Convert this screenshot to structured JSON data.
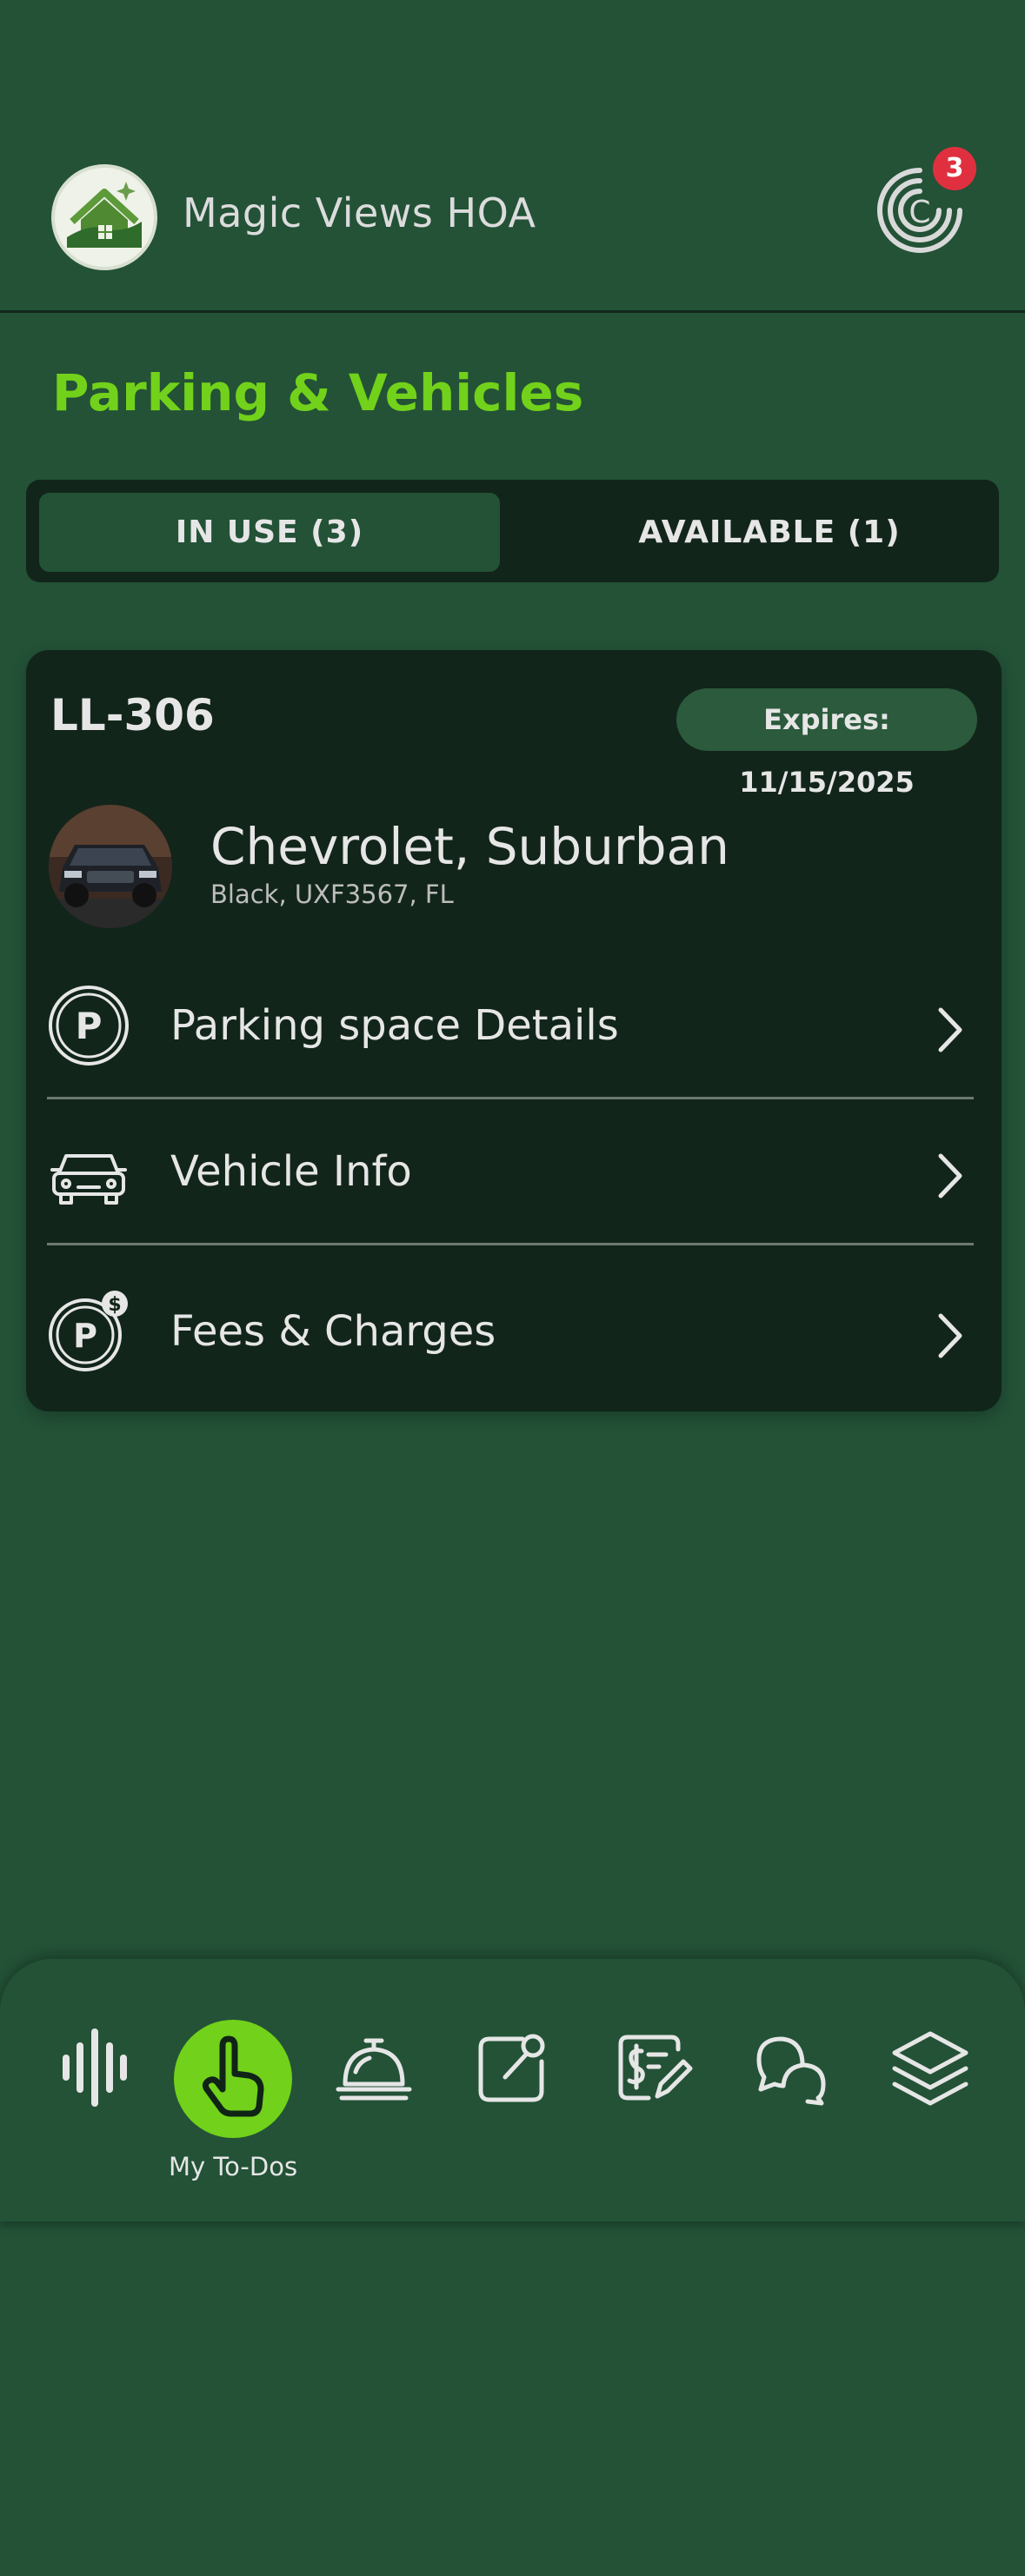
{
  "app": {
    "title": "Magic Views HOA",
    "notification_count": "3"
  },
  "page": {
    "title": "Parking & Vehicles"
  },
  "tabs": [
    {
      "label": "IN USE (3)",
      "active": true
    },
    {
      "label": "AVAILABLE (1)",
      "active": false
    }
  ],
  "card": {
    "space_id": "LL-306",
    "expires": "Expires: 11/15/2025",
    "vehicle": {
      "name": "Chevrolet, Suburban",
      "details": "Black,  UXF3567, FL"
    },
    "rows": [
      {
        "label": "Parking space Details",
        "icon": "parking-icon"
      },
      {
        "label": "Vehicle Info",
        "icon": "car-icon"
      },
      {
        "label": "Fees & Charges",
        "icon": "parking-fee-icon"
      }
    ]
  },
  "bottom_nav": {
    "items": [
      {
        "icon": "voice-wave-icon"
      },
      {
        "icon": "pointing-hand-icon",
        "label": "My To-Dos",
        "active": true
      },
      {
        "icon": "service-bell-icon"
      },
      {
        "icon": "edit-square-icon"
      },
      {
        "icon": "payment-edit-icon"
      },
      {
        "icon": "chat-bubbles-icon"
      },
      {
        "icon": "layers-icon"
      }
    ]
  },
  "colors": {
    "background": "#235237",
    "card": "#12251a",
    "accent_green": "#72d11a",
    "badge_red": "#e0303f"
  }
}
